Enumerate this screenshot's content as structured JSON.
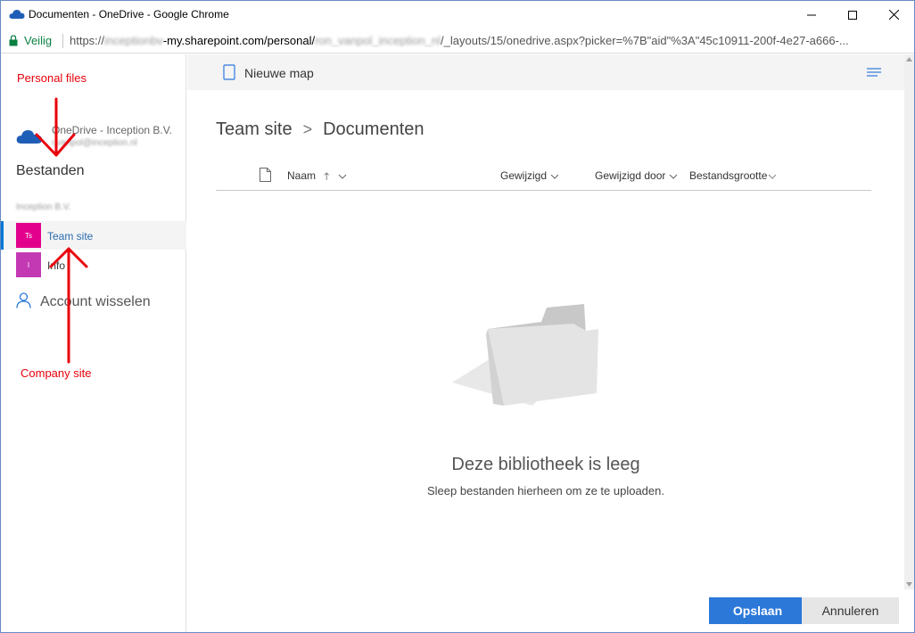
{
  "window": {
    "title": "Documenten - OneDrive - Google Chrome"
  },
  "address": {
    "secure_label": "Veilig",
    "url_prefix": "https://",
    "url_blur1": "inceptionbv",
    "url_mid": "-my.sharepoint.com/personal/",
    "url_blur2": "ron_vanpol_inception_nl",
    "url_suffix": "/_layouts/15/onedrive.aspx?picker=%7B\"aid\"%3A\"45c10911-200f-4e27-a666-..."
  },
  "left": {
    "onedrive_title": "OneDrive - Inception B.V.",
    "onedrive_email": "r.vanpol@inception.nl",
    "files_label": "Bestanden",
    "company_label": "Inception B.V.",
    "sites": [
      {
        "tile": "Ts",
        "label": "Team site",
        "color": "#e3008c",
        "selected": true
      },
      {
        "tile": "I",
        "label": "Info",
        "color": "#c239b3",
        "selected": false
      }
    ],
    "switch_account": "Account wisselen"
  },
  "annotations": {
    "personal_files": "Personal files",
    "company_site": "Company site",
    "color": "#e8000b"
  },
  "commandbar": {
    "new_folder": "Nieuwe map"
  },
  "breadcrumb": {
    "items": [
      "Team site",
      "Documenten"
    ],
    "separator": ">"
  },
  "columns": {
    "name": "Naam",
    "modified": "Gewijzigd",
    "modified_by": "Gewijzigd door",
    "size": "Bestandsgrootte"
  },
  "empty": {
    "title": "Deze bibliotheek is leeg",
    "subtitle": "Sleep bestanden hierheen om ze te uploaden."
  },
  "buttons": {
    "save": "Opslaan",
    "cancel": "Annuleren",
    "accent": "#2b78d9"
  }
}
